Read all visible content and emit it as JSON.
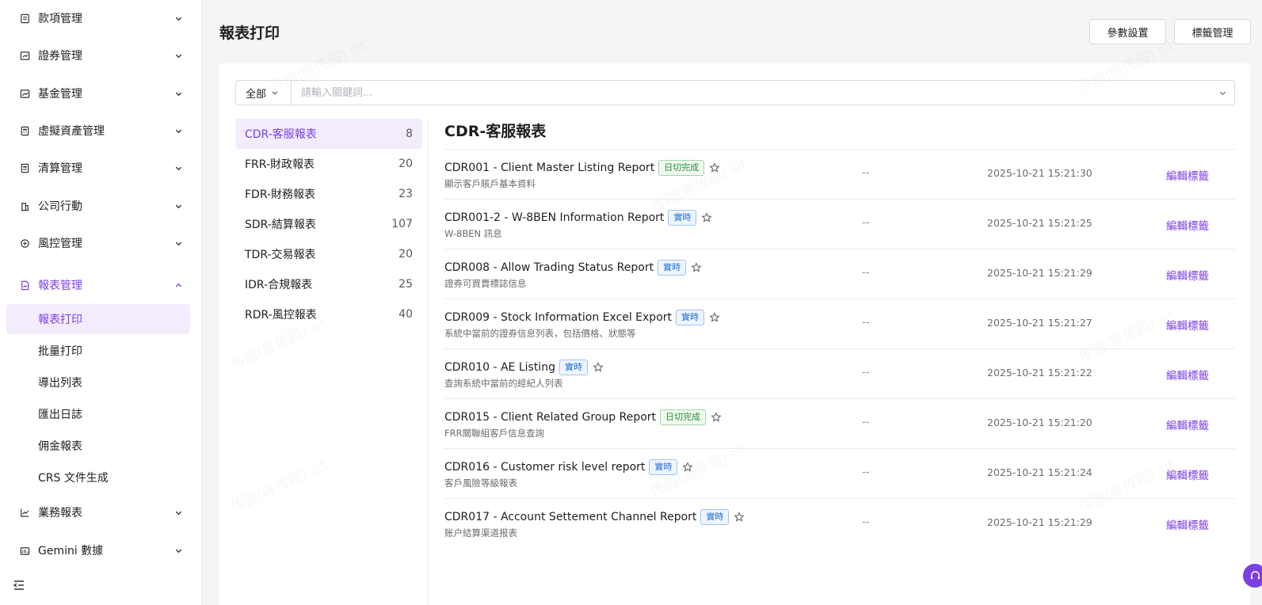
{
  "sidebar": {
    "items": [
      {
        "label": "款項管理",
        "icon": "ledger-icon"
      },
      {
        "label": "證券管理",
        "icon": "securities-icon"
      },
      {
        "label": "基金管理",
        "icon": "fund-chart-icon"
      },
      {
        "label": "虛擬資產管理",
        "icon": "virtual-asset-icon"
      },
      {
        "label": "清算管理",
        "icon": "clearing-icon"
      },
      {
        "label": "公司行動",
        "icon": "building-icon"
      },
      {
        "label": "風控管理",
        "icon": "risk-icon"
      },
      {
        "label": "報表管理",
        "icon": "report-icon"
      },
      {
        "label": "業務報表",
        "icon": "line-chart-icon"
      },
      {
        "label": "Gemini 數據",
        "icon": "bar-data-icon"
      }
    ],
    "subitems": [
      "報表打印",
      "批量打印",
      "導出列表",
      "匯出日誌",
      "佣金報表",
      "CRS 文件生成"
    ]
  },
  "header": {
    "title": "報表打印",
    "params_btn": "參數設置",
    "tags_btn": "標籤管理"
  },
  "search": {
    "scope": "全部",
    "placeholder": "請輸入關鍵詞..."
  },
  "categories": [
    {
      "label": "CDR-客服報表",
      "count": "8"
    },
    {
      "label": "FRR-財政報表",
      "count": "20"
    },
    {
      "label": "FDR-財務報表",
      "count": "23"
    },
    {
      "label": "SDR-結算報表",
      "count": "107"
    },
    {
      "label": "TDR-交易報表",
      "count": "20"
    },
    {
      "label": "IDR-合規報表",
      "count": "25"
    },
    {
      "label": "RDR-風控報表",
      "count": "40"
    }
  ],
  "section_title": "CDR-客服報表",
  "reports": [
    {
      "name": "CDR001 - Client Master Listing Report",
      "tag": "日切完成",
      "tag_color": "green",
      "desc": "顯示客戶賬戶基本資料",
      "dash": "--",
      "time": "2025-10-21 15:21:30",
      "action": "編輯標籤"
    },
    {
      "name": "CDR001-2 - W-8BEN Information Report",
      "tag": "實時",
      "tag_color": "blue",
      "desc": "W-8BEN 訊息",
      "dash": "--",
      "time": "2025-10-21 15:21:25",
      "action": "編輯標籤"
    },
    {
      "name": "CDR008 - Allow Trading Status Report",
      "tag": "實時",
      "tag_color": "blue",
      "desc": "證券可買賣標誌信息",
      "dash": "--",
      "time": "2025-10-21 15:21:29",
      "action": "編輯標籤"
    },
    {
      "name": "CDR009 - Stock Information Excel Export",
      "tag": "實時",
      "tag_color": "blue",
      "desc": "系統中當前的證券信息列表，包括價格、狀態等",
      "dash": "--",
      "time": "2025-10-21 15:21:27",
      "action": "編輯標籤"
    },
    {
      "name": "CDR010 - AE Listing",
      "tag": "實時",
      "tag_color": "blue",
      "desc": "查詢系統中當前的經紀人列表",
      "dash": "--",
      "time": "2025-10-21 15:21:22",
      "action": "編輯標籤"
    },
    {
      "name": "CDR015 - Client Related Group Report",
      "tag": "日切完成",
      "tag_color": "green",
      "desc": "FRR關聯組客戶信息查詢",
      "dash": "--",
      "time": "2025-10-21 15:21:20",
      "action": "編輯標籤"
    },
    {
      "name": "CDR016 - Customer risk level report",
      "tag": "實時",
      "tag_color": "blue",
      "desc": "客戶風險等級報表",
      "dash": "--",
      "time": "2025-10-21 15:21:24",
      "action": "編輯標籤"
    },
    {
      "name": "CDR017 - Account Settement Channel Report",
      "tag": "實時",
      "tag_color": "blue",
      "desc": "账户結算渠道报表",
      "dash": "--",
      "time": "2025-10-21 15:21:29",
      "action": "編輯標籤"
    }
  ],
  "watermark_text": "传圆(陈传圆) sit",
  "colors": {
    "accent": "#7b3fe4",
    "green_tag": "#2e8b3a",
    "blue_tag": "#1e6fd9"
  }
}
